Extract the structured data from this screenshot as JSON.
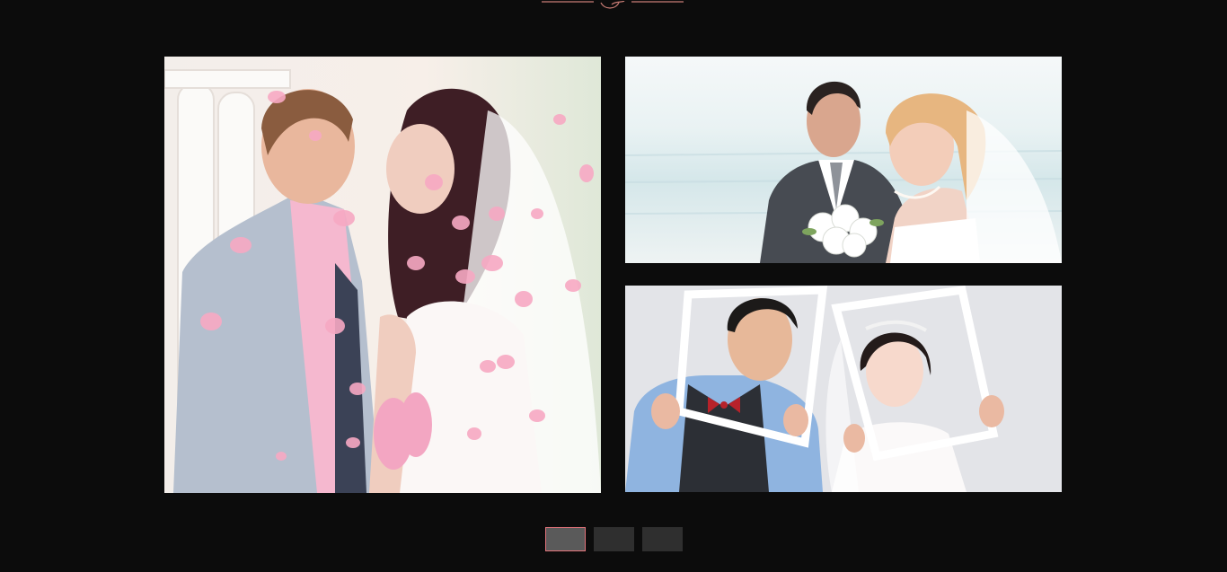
{
  "colors": {
    "background": "#0c0c0c",
    "accent": "#e2737a",
    "pager_inactive": "#2f2f2f",
    "pager_active": "#5a5a5a"
  },
  "gallery": {
    "photos": [
      {
        "name": "couple-kissing-petals"
      },
      {
        "name": "couple-beach-bouquet"
      },
      {
        "name": "couple-picture-frames"
      }
    ]
  },
  "pager": {
    "pages": 3,
    "active_index": 0
  }
}
